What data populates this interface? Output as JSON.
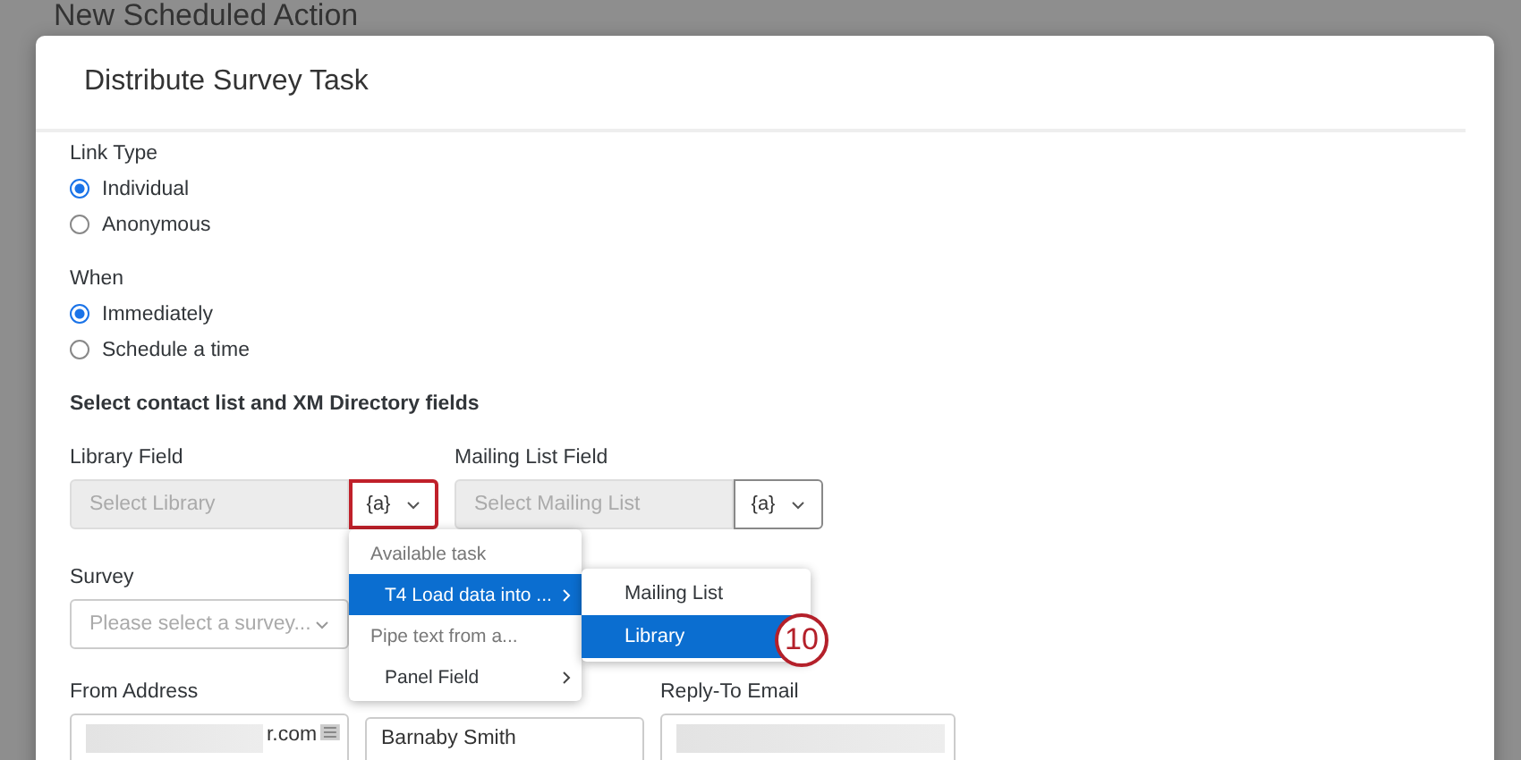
{
  "page_title": "New Scheduled Action",
  "dialog": {
    "title": "Distribute Survey Task",
    "radio_groups": [
      {
        "label": "Link Type",
        "options": [
          {
            "label": "Individual",
            "selected": true
          },
          {
            "label": "Anonymous",
            "selected": false
          }
        ]
      },
      {
        "label": "When",
        "options": [
          {
            "label": "Immediately",
            "selected": true
          },
          {
            "label": "Schedule a time",
            "selected": false
          }
        ]
      }
    ],
    "section_heading": "Select contact list and XM Directory fields",
    "library_field": {
      "label": "Library Field",
      "placeholder": "Select Library",
      "piped_button": {
        "label": "{a}",
        "highlighted": true
      }
    },
    "mailing_list_field": {
      "label": "Mailing List Field",
      "placeholder": "Select Mailing List",
      "piped_button": {
        "label": "{a}",
        "highlighted": false
      }
    },
    "survey": {
      "label": "Survey",
      "placeholder": "Please select a survey..."
    },
    "from_address": {
      "label": "From Address",
      "value": "r.com"
    },
    "from_name": {
      "value": "Barnaby Smith"
    },
    "reply_to_email": {
      "label": "Reply-To Email"
    }
  },
  "piped_text_menu": {
    "items": [
      {
        "label": "Available task",
        "disabled": true,
        "selected": false,
        "has_submenu": false
      },
      {
        "label": "T4 Load data into ...",
        "disabled": false,
        "selected": true,
        "has_submenu": true
      },
      {
        "label": "Pipe text from a...",
        "disabled": true,
        "selected": false,
        "has_submenu": false
      },
      {
        "label": "Panel Field",
        "disabled": false,
        "selected": false,
        "has_submenu": true
      }
    ]
  },
  "submenu": {
    "items": [
      {
        "label": "Mailing List",
        "selected": false
      },
      {
        "label": "Library",
        "selected": true
      }
    ]
  },
  "step_badge": "10"
}
